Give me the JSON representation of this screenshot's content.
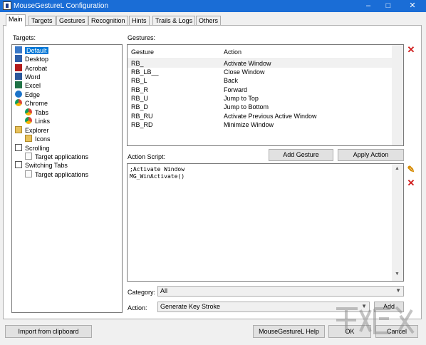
{
  "window": {
    "title": "MouseGestureL Configuration"
  },
  "tabs": [
    {
      "label": "Main"
    },
    {
      "label": "Targets"
    },
    {
      "label": "Gestures"
    },
    {
      "label": "Recognition"
    },
    {
      "label": "Hints"
    },
    {
      "label": "Trails & Logs"
    },
    {
      "label": "Others"
    }
  ],
  "targets": {
    "label": "Targets:",
    "items": [
      {
        "label": "Default",
        "icon": "default-icon",
        "selected": true
      },
      {
        "label": "Desktop",
        "icon": "desktop-icon"
      },
      {
        "label": "Acrobat",
        "icon": "acrobat-icon"
      },
      {
        "label": "Word",
        "icon": "word-icon"
      },
      {
        "label": "Excel",
        "icon": "excel-icon"
      },
      {
        "label": "Edge",
        "icon": "edge-icon"
      },
      {
        "label": "Chrome",
        "icon": "chrome-icon"
      },
      {
        "label": "Tabs",
        "icon": "chrome-icon"
      },
      {
        "label": "Links",
        "icon": "chrome-icon"
      },
      {
        "label": "Explorer",
        "icon": "folder-icon"
      },
      {
        "label": "Icons",
        "icon": "folder-icon"
      },
      {
        "label": "Scrolling",
        "icon": "scroll-icon"
      },
      {
        "label": "Target applications",
        "icon": "target-app-icon"
      },
      {
        "label": "Switching Tabs",
        "icon": "scroll-icon"
      },
      {
        "label": "Target applications",
        "icon": "target-app-icon"
      }
    ]
  },
  "gestures": {
    "label": "Gestures:",
    "col_gesture": "Gesture",
    "col_action": "Action",
    "rows": [
      {
        "gesture": "RB_",
        "action": "Activate Window"
      },
      {
        "gesture": "RB_LB__",
        "action": "Close Window"
      },
      {
        "gesture": "RB_L",
        "action": "Back"
      },
      {
        "gesture": "RB_R",
        "action": "Forward"
      },
      {
        "gesture": "RB_U",
        "action": "Jump to Top"
      },
      {
        "gesture": "RB_D",
        "action": "Jump to Bottom"
      },
      {
        "gesture": "RB_RU",
        "action": "Activate Previous Active Window"
      },
      {
        "gesture": "RB_RD",
        "action": "Minimize Window"
      }
    ]
  },
  "buttons": {
    "add_gesture": "Add Gesture",
    "apply_action": "Apply Action",
    "add": "Add",
    "import": "Import from clipboard",
    "help": "MouseGestureL Help",
    "ok": "OK",
    "cancel": "Cancel"
  },
  "script": {
    "label": "Action Script:",
    "line1": ";Activate Window",
    "line2": "MG_WinActivate()"
  },
  "category": {
    "label": "Category:",
    "value": "All"
  },
  "action": {
    "label": "Action:",
    "value": "Generate Key Stroke"
  },
  "colors": {
    "selection": "#0078d7",
    "titlebar": "#1a6dd6",
    "delete": "#d01b1b"
  }
}
